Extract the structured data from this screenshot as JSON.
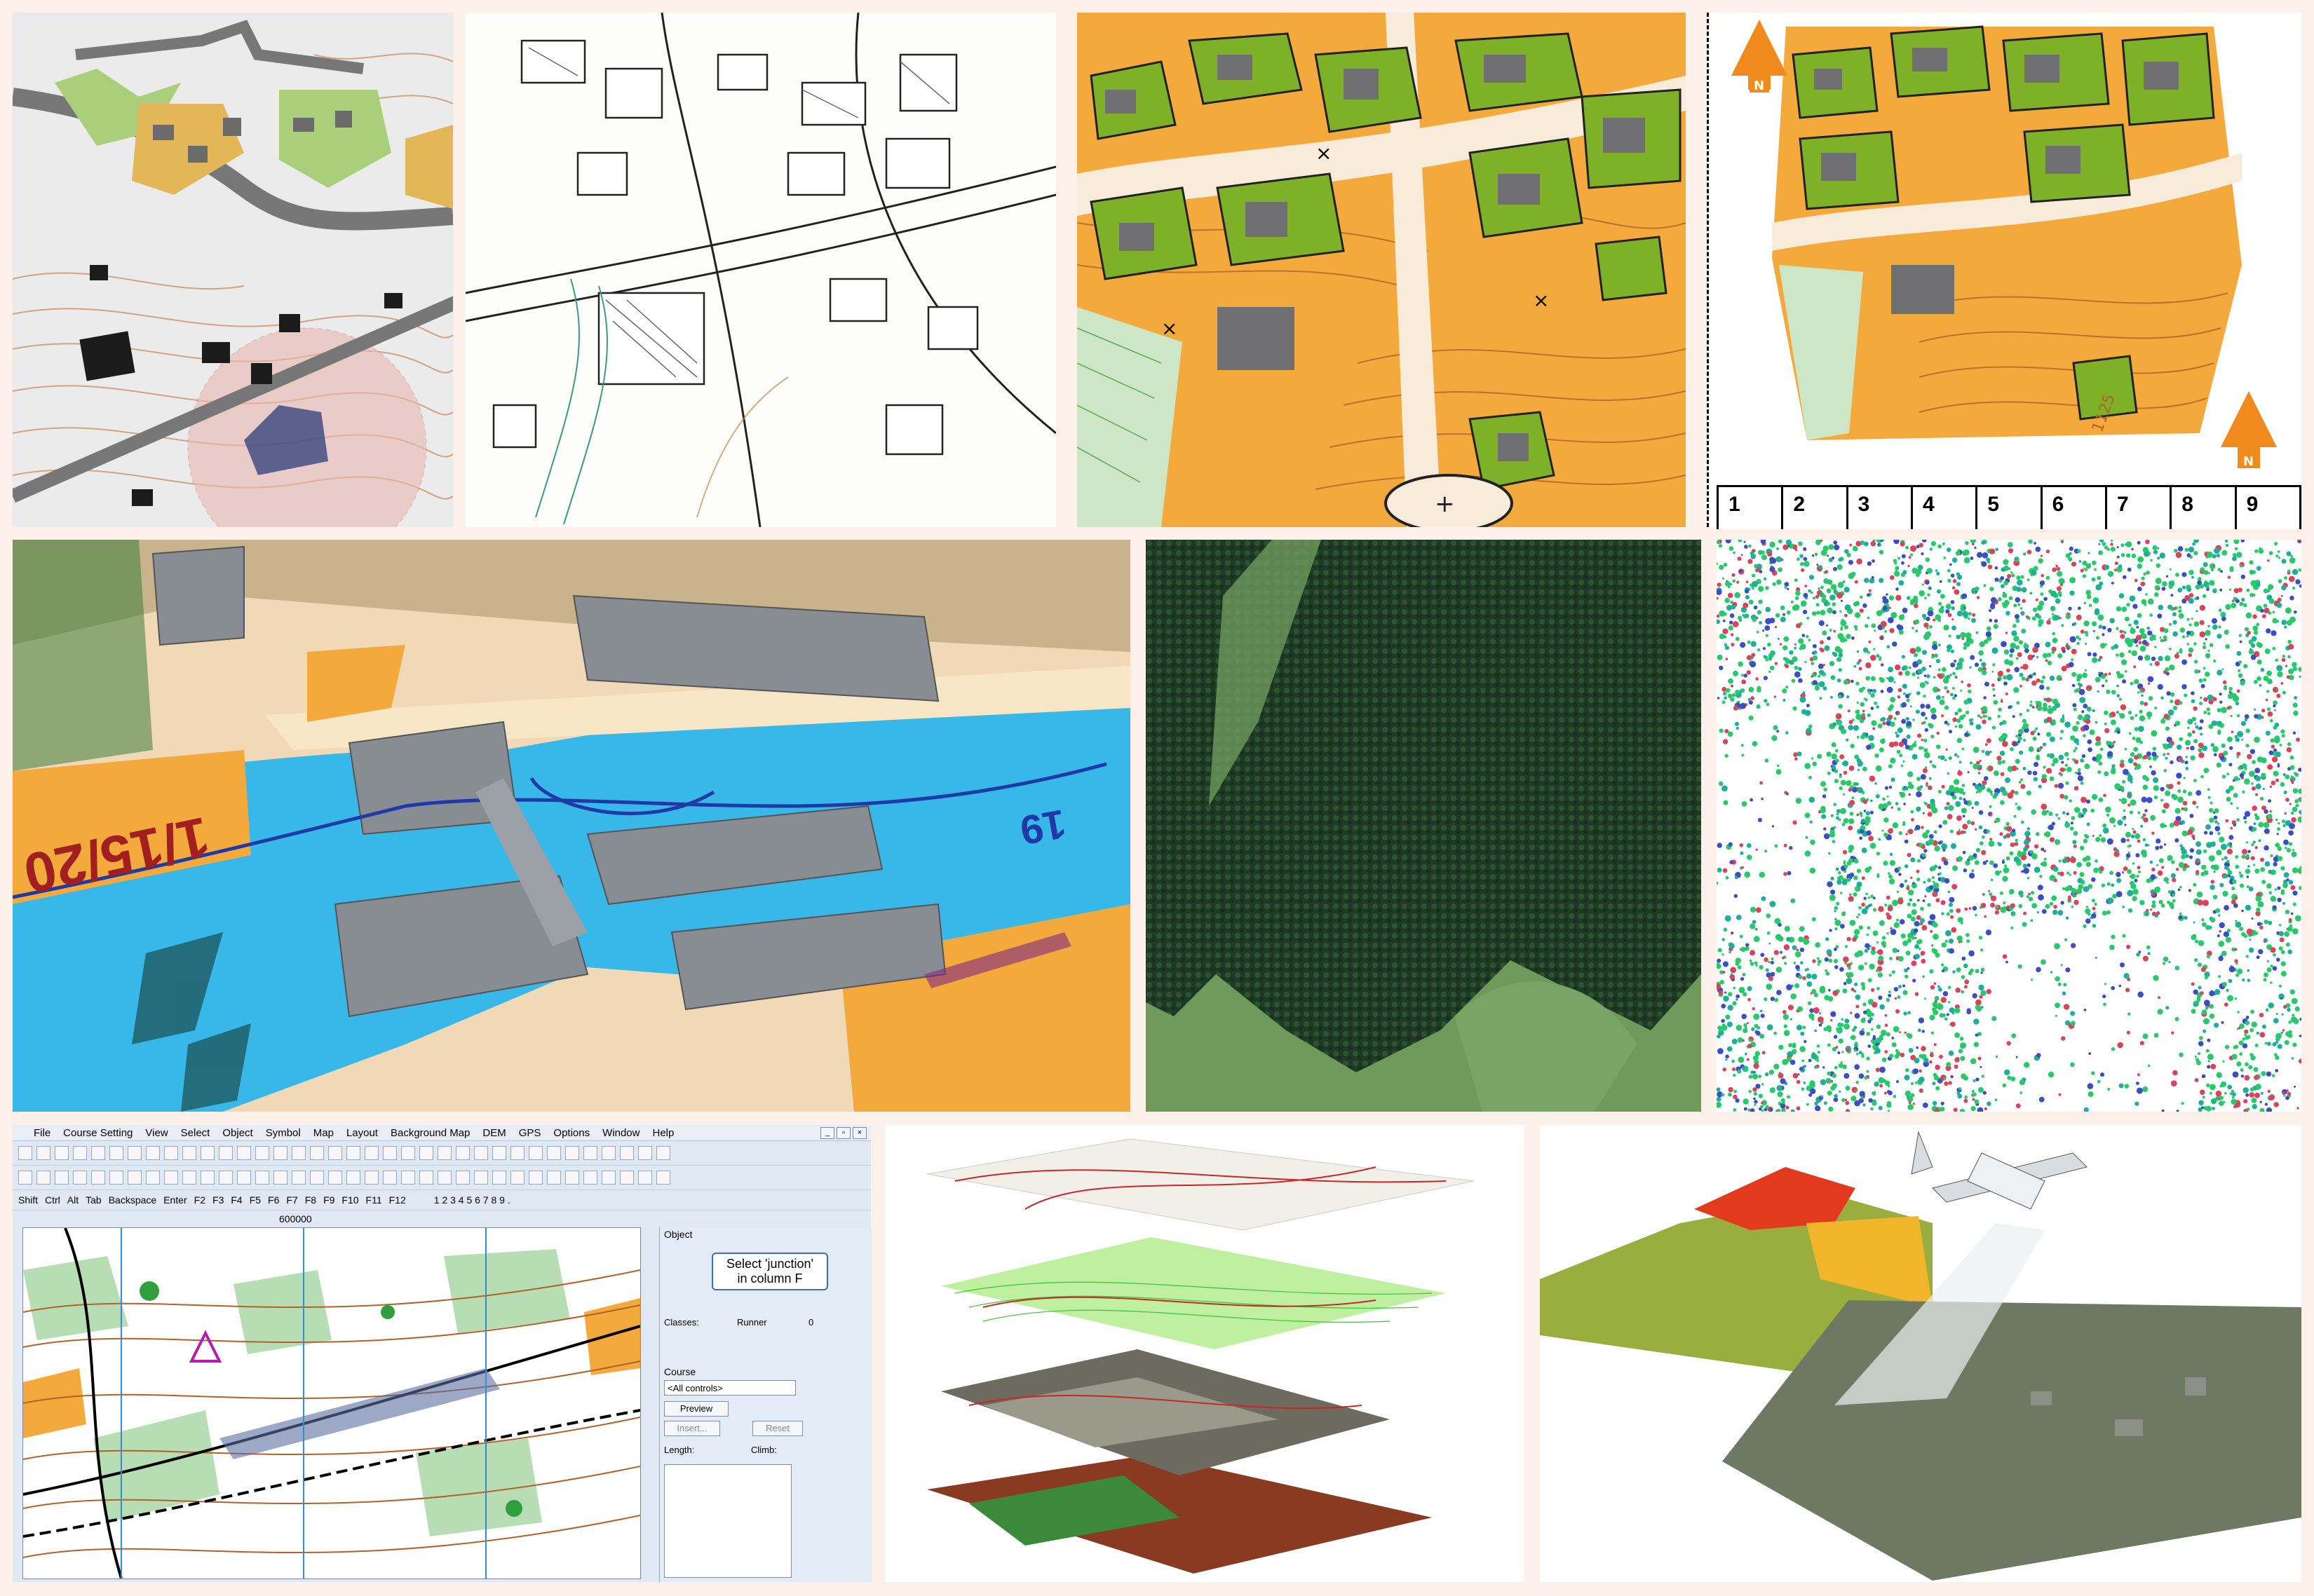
{
  "scale_bar": {
    "numbers": [
      "1",
      "2",
      "3",
      "4",
      "5",
      "6",
      "7",
      "8",
      "9"
    ]
  },
  "north_label": "N",
  "map_labels": {
    "harbour_control": "1/15/20",
    "harbour_number": "19",
    "contour_label": "1125"
  },
  "software": {
    "menu": [
      "File",
      "Course Setting",
      "View",
      "Select",
      "Object",
      "Symbol",
      "Map",
      "Layout",
      "Background Map",
      "DEM",
      "GPS",
      "Options",
      "Window",
      "Help"
    ],
    "function_keys": [
      "Shift",
      "Ctrl",
      "Alt",
      "Tab",
      "Backspace",
      "Enter",
      "F2",
      "F3",
      "F4",
      "F5",
      "F6",
      "F7",
      "F8",
      "F9",
      "F10",
      "F11",
      "F12"
    ],
    "number_keys": "1 2 3 4 5 6 7 8 9 .",
    "coordinate": "600000",
    "object_section": "Object",
    "tooltip_line1": "Select 'junction'",
    "tooltip_line2": "in column F",
    "classes_label": "Classes:",
    "classes_value": "Runner",
    "classes_count": "0",
    "course_section": "Course",
    "course_select": "<All controls>",
    "preview_button": "Preview",
    "insert_button": "Insert...",
    "reset_button": "Reset",
    "length_label": "Length:",
    "climb_label": "Climb:"
  },
  "colors": {
    "background": "#fbf1ea",
    "orienteering_orange": "#f4a93c",
    "vegetation_green": "#7fb128",
    "building_grey": "#6f6f72",
    "contour_brown": "#b5602a",
    "water_blue": "#37b8e8",
    "forest_dark": "#24442a",
    "lidar_green": "#27c96a",
    "north_arrow": "#f08a1c"
  }
}
